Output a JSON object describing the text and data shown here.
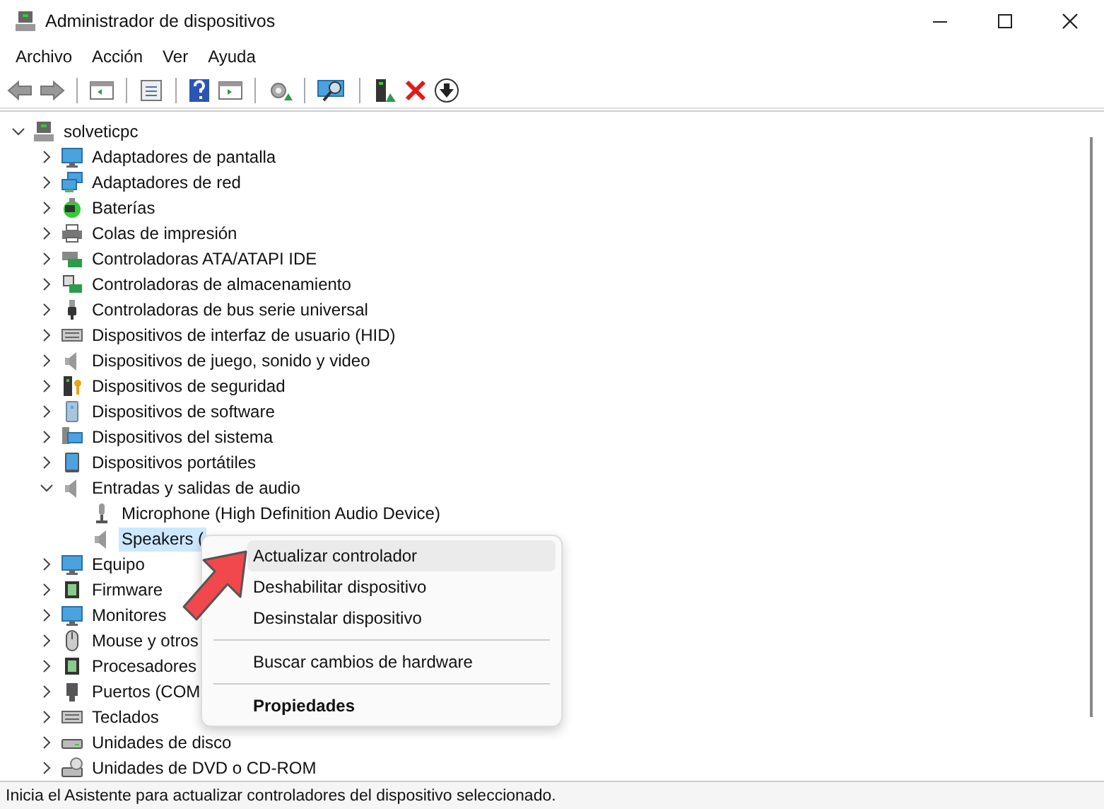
{
  "window": {
    "title": "Administrador de dispositivos"
  },
  "menu": [
    "Archivo",
    "Acción",
    "Ver",
    "Ayuda"
  ],
  "tree": {
    "label": "solveticpc",
    "expanded": true,
    "children": [
      {
        "label": "Adaptadores de pantalla",
        "expanded": false
      },
      {
        "label": "Adaptadores de red",
        "expanded": false
      },
      {
        "label": "Baterías",
        "expanded": false
      },
      {
        "label": "Colas de impresión",
        "expanded": false
      },
      {
        "label": "Controladoras ATA/ATAPI IDE",
        "expanded": false
      },
      {
        "label": "Controladoras de almacenamiento",
        "expanded": false
      },
      {
        "label": "Controladoras de bus serie universal",
        "expanded": false
      },
      {
        "label": "Dispositivos de interfaz de usuario (HID)",
        "expanded": false
      },
      {
        "label": "Dispositivos de juego, sonido y video",
        "expanded": false
      },
      {
        "label": "Dispositivos de seguridad",
        "expanded": false
      },
      {
        "label": "Dispositivos de software",
        "expanded": false
      },
      {
        "label": "Dispositivos del sistema",
        "expanded": false
      },
      {
        "label": "Dispositivos portátiles",
        "expanded": false
      },
      {
        "label": "Entradas y salidas de audio",
        "expanded": true,
        "children": [
          {
            "label": "Microphone (High Definition Audio Device)",
            "selected": false
          },
          {
            "label": "Speakers (",
            "selected": true
          }
        ]
      },
      {
        "label": "Equipo",
        "expanded": false
      },
      {
        "label": "Firmware",
        "expanded": false
      },
      {
        "label": "Monitores",
        "expanded": false
      },
      {
        "label": "Mouse y otros",
        "expanded": false
      },
      {
        "label": "Procesadores",
        "expanded": false
      },
      {
        "label": "Puertos (COM",
        "expanded": false
      },
      {
        "label": "Teclados",
        "expanded": false
      },
      {
        "label": "Unidades de disco",
        "expanded": false
      },
      {
        "label": "Unidades de DVD o CD-ROM",
        "expanded": false
      }
    ]
  },
  "context_menu": [
    {
      "kind": "item",
      "label": "Actualizar controlador",
      "selected": true
    },
    {
      "kind": "item",
      "label": "Deshabilitar dispositivo",
      "selected": false
    },
    {
      "kind": "item",
      "label": "Desinstalar dispositivo",
      "selected": false
    },
    {
      "kind": "separator"
    },
    {
      "kind": "item",
      "label": "Buscar cambios de hardware",
      "selected": false
    },
    {
      "kind": "separator"
    },
    {
      "kind": "default",
      "label": "Propiedades",
      "selected": false
    }
  ],
  "status_bar": "Inicia el Asistente para actualizar controladores del dispositivo seleccionado."
}
